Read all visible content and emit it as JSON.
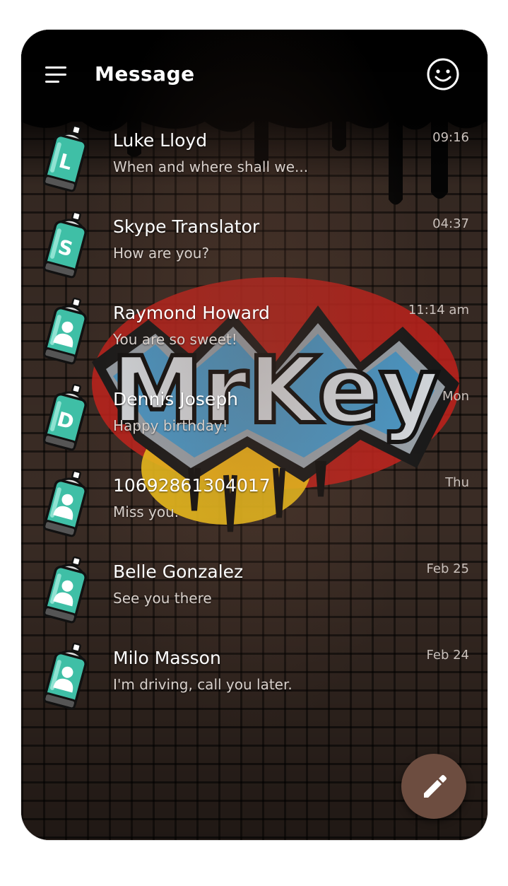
{
  "header": {
    "title": "Message",
    "menu_icon": "hamburger-menu-icon",
    "emoji_icon": "smiley-face-icon"
  },
  "background": {
    "graffiti_text": "MrKey",
    "colors": {
      "teal": "#3fbfa6",
      "red": "#d4241c",
      "yellow": "#f2c21b",
      "blue": "#2b95d6",
      "fab": "#6d4d40"
    }
  },
  "conversations": [
    {
      "avatar_letter": "L",
      "avatar_type": "letter",
      "name": "Luke Lloyd",
      "preview": "When and where shall we...",
      "time": "09:16"
    },
    {
      "avatar_letter": "S",
      "avatar_type": "letter",
      "name": "Skype Translator",
      "preview": "How are you?",
      "time": "04:37"
    },
    {
      "avatar_letter": "",
      "avatar_type": "person",
      "name": "Raymond Howard",
      "preview": "You are so sweet!",
      "time": "11:14 am"
    },
    {
      "avatar_letter": "D",
      "avatar_type": "letter",
      "name": "Dennis Joseph",
      "preview": "Happy birthday!",
      "time": "Mon"
    },
    {
      "avatar_letter": "",
      "avatar_type": "person",
      "name": "10692861304017",
      "preview": "Miss you.",
      "time": "Thu"
    },
    {
      "avatar_letter": "",
      "avatar_type": "person",
      "name": "Belle Gonzalez",
      "preview": "See you there",
      "time": "Feb 25"
    },
    {
      "avatar_letter": "",
      "avatar_type": "person",
      "name": "Milo Masson",
      "preview": "I'm driving, call you later.",
      "time": "Feb 24"
    }
  ],
  "fab": {
    "icon": "pencil-compose-icon"
  }
}
